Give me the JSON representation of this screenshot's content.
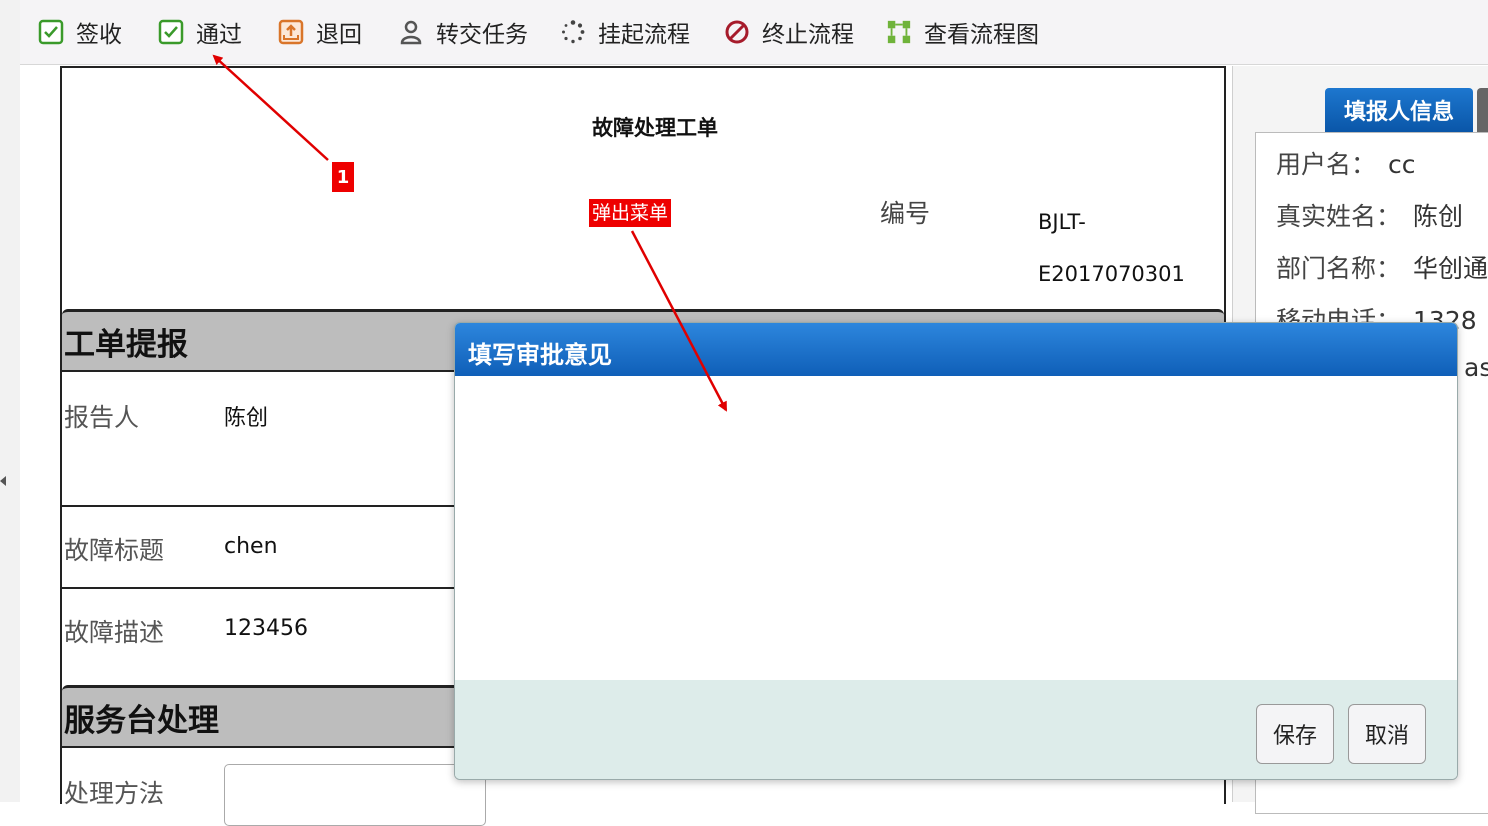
{
  "toolbar": {
    "items": [
      {
        "label": "签收",
        "icon": "check-box-icon"
      },
      {
        "label": "通过",
        "icon": "check-box-icon"
      },
      {
        "label": "退回",
        "icon": "return-box-icon"
      },
      {
        "label": "转交任务",
        "icon": "user-icon"
      },
      {
        "label": "挂起流程",
        "icon": "spinner-icon"
      },
      {
        "label": "终止流程",
        "icon": "stop-icon"
      },
      {
        "label": "查看流程图",
        "icon": "flowchart-icon"
      }
    ]
  },
  "form": {
    "title": "故障处理工单",
    "number_label": "编号",
    "number_value": "BJLT-E2017070301",
    "sections": {
      "report": "工单提报",
      "service": "服务台处理"
    },
    "fields": {
      "reporter_label": "报告人",
      "reporter_value": "陈创",
      "fault_title_label": "故障标题",
      "fault_title_value": "chen",
      "fault_desc_label": "故障描述",
      "fault_desc_value": "123456",
      "method_label": "处理方法"
    }
  },
  "annotations": {
    "badge_1": "1",
    "popup_menu": "弹出菜单",
    "color": "#e00000"
  },
  "right_panel": {
    "tab_label": "填报人信息",
    "rows": [
      {
        "label": "用户名：",
        "value": "cc"
      },
      {
        "label": "真实姓名：",
        "value": "陈创"
      },
      {
        "label": "部门名称：",
        "value": "华创通"
      },
      {
        "label": "移动电话：",
        "value": "1328"
      },
      {
        "label": "",
        "value": "as@"
      }
    ]
  },
  "dialog": {
    "title": "填写审批意见",
    "save_label": "保存",
    "cancel_label": "取消"
  },
  "colors": {
    "dialog_header": "#1a6fc9",
    "dialog_footer": "#ddecea",
    "section_band": "#bdbdbd"
  }
}
